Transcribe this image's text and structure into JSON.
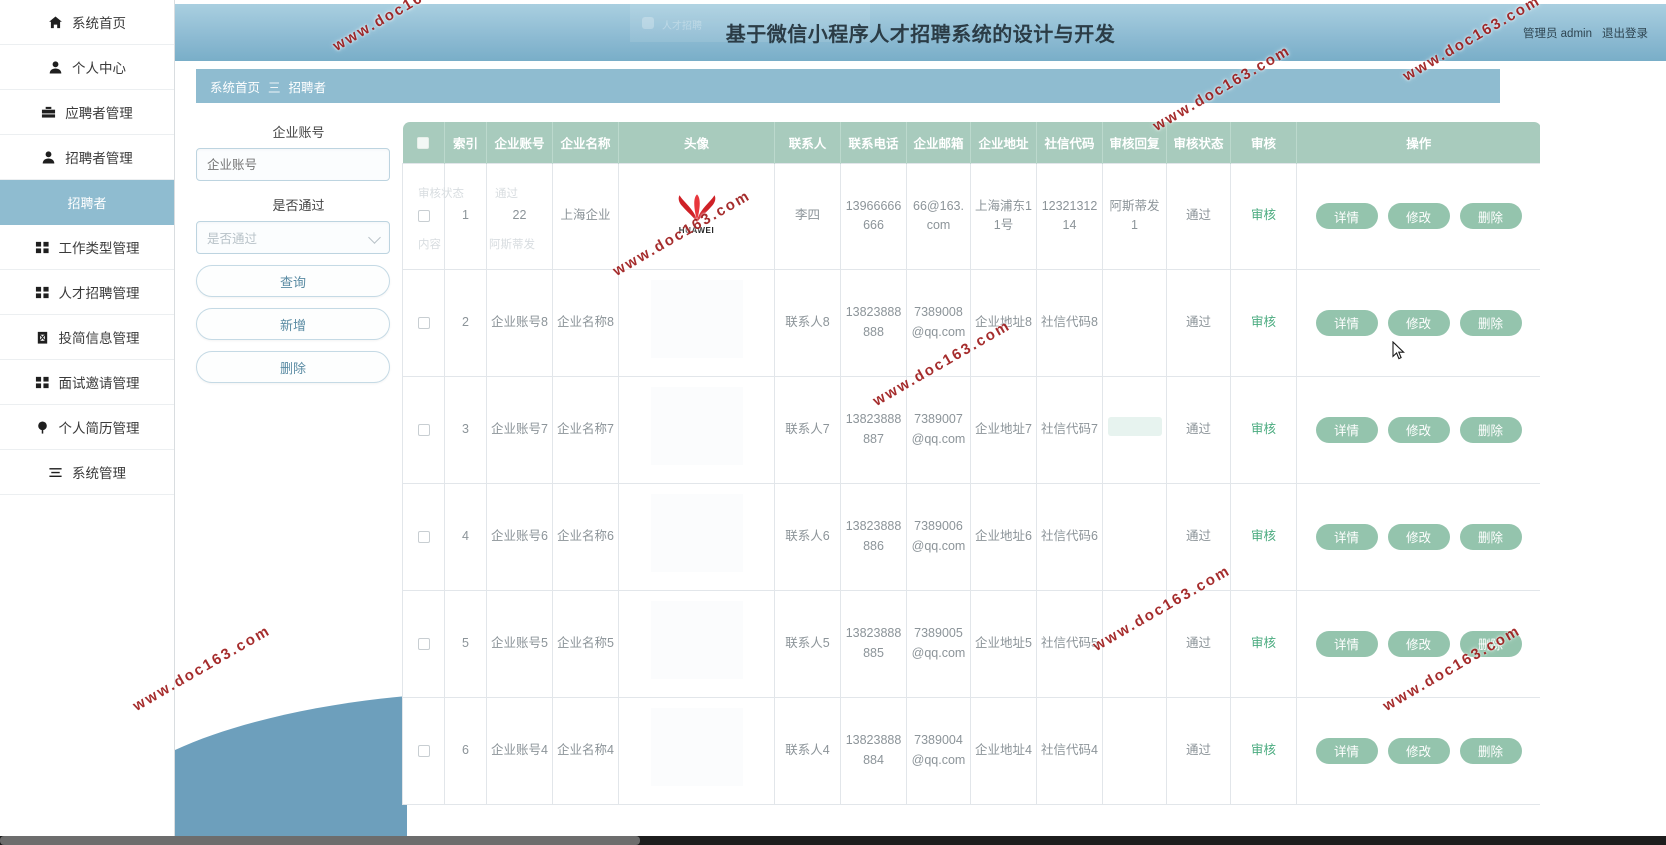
{
  "header": {
    "title": "基于微信小程序人才招聘系统的设计与开发",
    "admin_label": "管理员 admin",
    "logout_label": "退出登录",
    "ghost_label": "人才招聘"
  },
  "breadcrumb": {
    "home": "系统首页",
    "separator": "三",
    "current": "招聘者"
  },
  "sidebar": {
    "items": [
      {
        "label": "系统首页",
        "icon": "home-icon",
        "active": false
      },
      {
        "label": "个人中心",
        "icon": "user-icon",
        "active": false
      },
      {
        "label": "应聘者管理",
        "icon": "briefcase-icon",
        "active": false
      },
      {
        "label": "招聘者管理",
        "icon": "user-icon",
        "active": false
      },
      {
        "label": "招聘者",
        "icon": "none",
        "active": true
      },
      {
        "label": "工作类型管理",
        "icon": "grid-icon",
        "active": false
      },
      {
        "label": "人才招聘管理",
        "icon": "grid-icon",
        "active": false
      },
      {
        "label": "投简信息管理",
        "icon": "clipboard-icon",
        "active": false
      },
      {
        "label": "面试邀请管理",
        "icon": "grid-icon",
        "active": false
      },
      {
        "label": "个人简历管理",
        "icon": "pin-icon",
        "active": false
      },
      {
        "label": "系统管理",
        "icon": "menu-icon",
        "active": false
      }
    ]
  },
  "search": {
    "account_label": "企业账号",
    "account_placeholder": "企业账号",
    "account_value": "",
    "pass_label": "是否通过",
    "pass_placeholder": "是否通过",
    "pass_value": "",
    "buttons": {
      "query": "查询",
      "add": "新增",
      "delete": "删除"
    }
  },
  "table": {
    "columns": [
      "",
      "索引",
      "企业账号",
      "企业名称",
      "头像",
      "联系人",
      "联系电话",
      "企业邮箱",
      "企业地址",
      "社信代码",
      "审核回复",
      "审核状态",
      "审核",
      "操作"
    ],
    "header_ghost": "审核",
    "rows": [
      {
        "index": "1",
        "account": "22",
        "name": "上海企业",
        "avatar": "huawei-logo",
        "contact": "李四",
        "phone": "13966666666",
        "email": "66@163.com",
        "address": "上海浦东11号",
        "credit_code": "1232131214",
        "audit_reply": "阿斯蒂发1",
        "audit_status": "通过",
        "audit": "审核"
      },
      {
        "index": "2",
        "account": "企业账号8",
        "name": "企业名称8",
        "avatar": "",
        "contact": "联系人8",
        "phone": "13823888888",
        "email": "7389008@qq.com",
        "address": "企业地址8",
        "credit_code": "社信代码8",
        "audit_reply": "",
        "audit_status": "通过",
        "audit": "审核"
      },
      {
        "index": "3",
        "account": "企业账号7",
        "name": "企业名称7",
        "avatar": "",
        "contact": "联系人7",
        "phone": "13823888887",
        "email": "7389007@qq.com",
        "address": "企业地址7",
        "credit_code": "社信代码7",
        "audit_reply": "",
        "audit_status": "通过",
        "audit": "审核"
      },
      {
        "index": "4",
        "account": "企业账号6",
        "name": "企业名称6",
        "avatar": "",
        "contact": "联系人6",
        "phone": "13823888886",
        "email": "7389006@qq.com",
        "address": "企业地址6",
        "credit_code": "社信代码6",
        "audit_reply": "",
        "audit_status": "通过",
        "audit": "审核"
      },
      {
        "index": "5",
        "account": "企业账号5",
        "name": "企业名称5",
        "avatar": "",
        "contact": "联系人5",
        "phone": "13823888885",
        "email": "7389005@qq.com",
        "address": "企业地址5",
        "credit_code": "社信代码5",
        "audit_reply": "",
        "audit_status": "通过",
        "audit": "审核"
      },
      {
        "index": "6",
        "account": "企业账号4",
        "name": "企业名称4",
        "avatar": "",
        "contact": "联系人4",
        "phone": "13823888884",
        "email": "7389004@qq.com",
        "address": "企业地址4",
        "credit_code": "社信代码4",
        "audit_reply": "",
        "audit_status": "通过",
        "audit": "审核"
      }
    ],
    "row_actions": {
      "detail": "详情",
      "edit": "修改",
      "delete": "删除"
    }
  },
  "avatar_logo": {
    "brand": "HUAWEI"
  },
  "watermark": {
    "text": "www.doc163.com"
  },
  "colors": {
    "header_blue": "#8cbad2",
    "sidebar_active": "#8fbcd0",
    "table_header_green": "#a8cbbd",
    "action_button": "#94c4ad",
    "audit_link": "#4aab7f",
    "wave_blue": "#6d9fbc"
  }
}
